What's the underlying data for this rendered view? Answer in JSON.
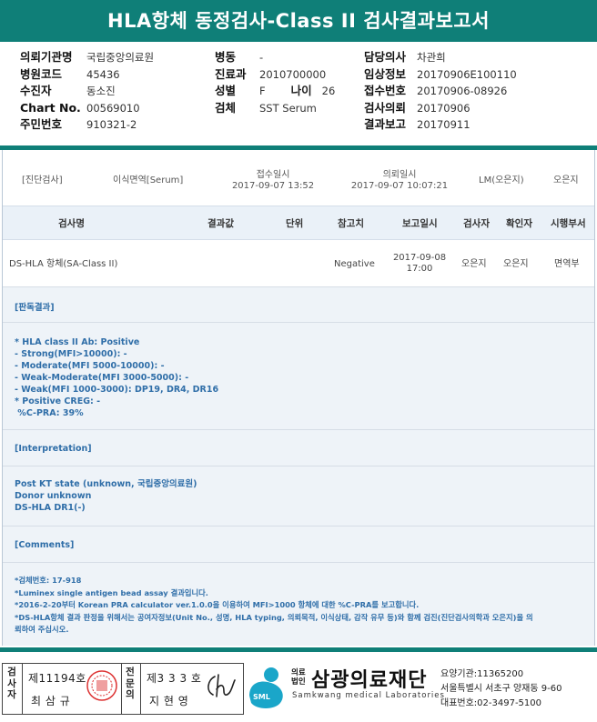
{
  "report": {
    "title": "HLA항체 동정검사-Class II 검사결과보고서"
  },
  "patient": {
    "col1": [
      {
        "label": "의뢰기관명",
        "value": "국립중앙의료원"
      },
      {
        "label": "병원코드",
        "value": "45436"
      },
      {
        "label": "수진자",
        "value": "동소진"
      },
      {
        "label": "Chart No.",
        "value": "00569010"
      },
      {
        "label": "주민번호",
        "value": "910321-2"
      }
    ],
    "col2": {
      "ward": {
        "label": "병동",
        "value": "-"
      },
      "dept": {
        "label": "진료과",
        "value": "2010700000"
      },
      "sex": {
        "label": "성별",
        "value": "F"
      },
      "age": {
        "label": "나이",
        "value": "26"
      },
      "specimen": {
        "label": "검체",
        "value": "SST Serum"
      }
    },
    "col3": [
      {
        "label": "담당의사",
        "value": "차관희"
      },
      {
        "label": "임상정보",
        "value": "20170906E100110"
      },
      {
        "label": "접수번호",
        "value": "20170906-08926"
      },
      {
        "label": "검사의뢰",
        "value": "20170906"
      },
      {
        "label": "결과보고",
        "value": "20170911"
      }
    ]
  },
  "meta": {
    "dept_label": "[진단검사]",
    "test_type": "이식면역[Serum]",
    "received_label": "접수일시",
    "received_value": "2017-09-07 13:52",
    "requested_label": "의뢰일시",
    "requested_value": "2017-09-07 10:07:21",
    "lm": "LM(오은지)",
    "person": "오은지"
  },
  "table": {
    "headers": [
      "검사명",
      "결과값",
      "단위",
      "참고치",
      "보고일시",
      "검사자",
      "확인자",
      "시행부서"
    ],
    "row": {
      "name": "DS-HLA 항체(SA-Class II)",
      "result": "",
      "unit": "",
      "reference": "Negative",
      "report_date": "2017-09-08",
      "report_time": "17:00",
      "tester": "오은지",
      "confirmer": "오은지",
      "dept": "면역부"
    }
  },
  "sections": {
    "judgement_title": "[판독결과]",
    "judgement_body": "* HLA class II Ab: Positive\n- Strong(MFI>10000): -\n- Moderate(MFI 5000-10000): -\n- Weak-Moderate(MFI 3000-5000): -\n- Weak(MFI 1000-3000): DP19, DR4, DR16\n* Positive CREG: -\n %C-PRA: 39%",
    "interp_title": "[Interpretation]",
    "interp_body": "Post KT state (unknown, 국립중앙의료원)\nDonor unknown\nDS-HLA DR1(-)",
    "comments_title": "[Comments]",
    "comments_body": "*검체번호: 17-918\n*Luminex single antigen bead assay 결과입니다.\n*2016-2-20부터 Korean PRA calculator ver.1.0.0을 이용하여 MFI>1000 항체에 대한 %C-PRA를 보고합니다.\n*DS-HLA항체 결과 판정을 위해서는 공여자정보(Unit No., 성명, HLA typing, 의뢰목적, 이식상태, 감작 유무 등)와 함께 검진(진단검사의학과 오은지)을 의\n뢰하여 주십시오."
  },
  "signatures": {
    "tester_label": "검사자",
    "tester_license": "제11194호",
    "tester_name": "최 삼 규",
    "specialist_label": "전문의",
    "specialist_license": "제3 3 3 호",
    "specialist_name": "지 현 영"
  },
  "company": {
    "logo_abbr": "SML",
    "legal_label_1": "의료",
    "legal_label_2": "법인",
    "name": "삼광의료재단",
    "name_en": "Samkwang medical Laboratories",
    "code": "요양기관:11365200",
    "address": "서울특별시 서초구 양재동 9-60",
    "phone": "대표번호:02-3497-5100",
    "accent_color": "#0f7f78",
    "logo_color": "#1aa6c9"
  }
}
